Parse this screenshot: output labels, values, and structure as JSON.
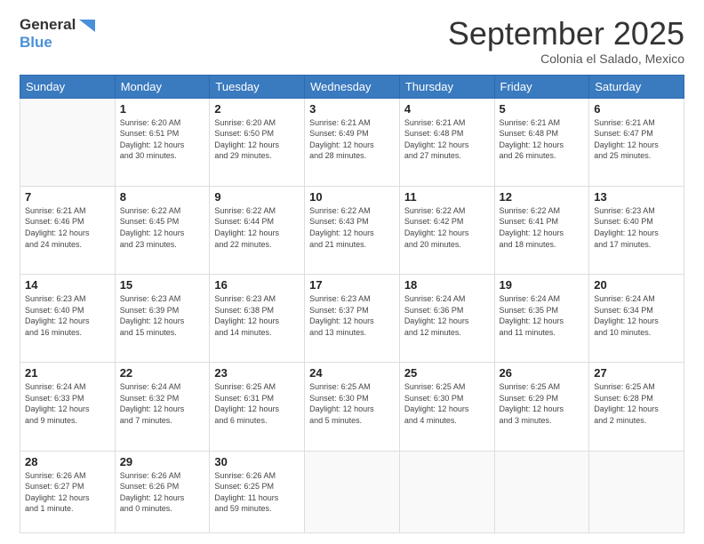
{
  "header": {
    "logo_general": "General",
    "logo_blue": "Blue",
    "month_title": "September 2025",
    "subtitle": "Colonia el Salado, Mexico"
  },
  "days_of_week": [
    "Sunday",
    "Monday",
    "Tuesday",
    "Wednesday",
    "Thursday",
    "Friday",
    "Saturday"
  ],
  "weeks": [
    [
      {
        "day": "",
        "info": ""
      },
      {
        "day": "1",
        "info": "Sunrise: 6:20 AM\nSunset: 6:51 PM\nDaylight: 12 hours\nand 30 minutes."
      },
      {
        "day": "2",
        "info": "Sunrise: 6:20 AM\nSunset: 6:50 PM\nDaylight: 12 hours\nand 29 minutes."
      },
      {
        "day": "3",
        "info": "Sunrise: 6:21 AM\nSunset: 6:49 PM\nDaylight: 12 hours\nand 28 minutes."
      },
      {
        "day": "4",
        "info": "Sunrise: 6:21 AM\nSunset: 6:48 PM\nDaylight: 12 hours\nand 27 minutes."
      },
      {
        "day": "5",
        "info": "Sunrise: 6:21 AM\nSunset: 6:48 PM\nDaylight: 12 hours\nand 26 minutes."
      },
      {
        "day": "6",
        "info": "Sunrise: 6:21 AM\nSunset: 6:47 PM\nDaylight: 12 hours\nand 25 minutes."
      }
    ],
    [
      {
        "day": "7",
        "info": "Sunrise: 6:21 AM\nSunset: 6:46 PM\nDaylight: 12 hours\nand 24 minutes."
      },
      {
        "day": "8",
        "info": "Sunrise: 6:22 AM\nSunset: 6:45 PM\nDaylight: 12 hours\nand 23 minutes."
      },
      {
        "day": "9",
        "info": "Sunrise: 6:22 AM\nSunset: 6:44 PM\nDaylight: 12 hours\nand 22 minutes."
      },
      {
        "day": "10",
        "info": "Sunrise: 6:22 AM\nSunset: 6:43 PM\nDaylight: 12 hours\nand 21 minutes."
      },
      {
        "day": "11",
        "info": "Sunrise: 6:22 AM\nSunset: 6:42 PM\nDaylight: 12 hours\nand 20 minutes."
      },
      {
        "day": "12",
        "info": "Sunrise: 6:22 AM\nSunset: 6:41 PM\nDaylight: 12 hours\nand 18 minutes."
      },
      {
        "day": "13",
        "info": "Sunrise: 6:23 AM\nSunset: 6:40 PM\nDaylight: 12 hours\nand 17 minutes."
      }
    ],
    [
      {
        "day": "14",
        "info": "Sunrise: 6:23 AM\nSunset: 6:40 PM\nDaylight: 12 hours\nand 16 minutes."
      },
      {
        "day": "15",
        "info": "Sunrise: 6:23 AM\nSunset: 6:39 PM\nDaylight: 12 hours\nand 15 minutes."
      },
      {
        "day": "16",
        "info": "Sunrise: 6:23 AM\nSunset: 6:38 PM\nDaylight: 12 hours\nand 14 minutes."
      },
      {
        "day": "17",
        "info": "Sunrise: 6:23 AM\nSunset: 6:37 PM\nDaylight: 12 hours\nand 13 minutes."
      },
      {
        "day": "18",
        "info": "Sunrise: 6:24 AM\nSunset: 6:36 PM\nDaylight: 12 hours\nand 12 minutes."
      },
      {
        "day": "19",
        "info": "Sunrise: 6:24 AM\nSunset: 6:35 PM\nDaylight: 12 hours\nand 11 minutes."
      },
      {
        "day": "20",
        "info": "Sunrise: 6:24 AM\nSunset: 6:34 PM\nDaylight: 12 hours\nand 10 minutes."
      }
    ],
    [
      {
        "day": "21",
        "info": "Sunrise: 6:24 AM\nSunset: 6:33 PM\nDaylight: 12 hours\nand 9 minutes."
      },
      {
        "day": "22",
        "info": "Sunrise: 6:24 AM\nSunset: 6:32 PM\nDaylight: 12 hours\nand 7 minutes."
      },
      {
        "day": "23",
        "info": "Sunrise: 6:25 AM\nSunset: 6:31 PM\nDaylight: 12 hours\nand 6 minutes."
      },
      {
        "day": "24",
        "info": "Sunrise: 6:25 AM\nSunset: 6:30 PM\nDaylight: 12 hours\nand 5 minutes."
      },
      {
        "day": "25",
        "info": "Sunrise: 6:25 AM\nSunset: 6:30 PM\nDaylight: 12 hours\nand 4 minutes."
      },
      {
        "day": "26",
        "info": "Sunrise: 6:25 AM\nSunset: 6:29 PM\nDaylight: 12 hours\nand 3 minutes."
      },
      {
        "day": "27",
        "info": "Sunrise: 6:25 AM\nSunset: 6:28 PM\nDaylight: 12 hours\nand 2 minutes."
      }
    ],
    [
      {
        "day": "28",
        "info": "Sunrise: 6:26 AM\nSunset: 6:27 PM\nDaylight: 12 hours\nand 1 minute."
      },
      {
        "day": "29",
        "info": "Sunrise: 6:26 AM\nSunset: 6:26 PM\nDaylight: 12 hours\nand 0 minutes."
      },
      {
        "day": "30",
        "info": "Sunrise: 6:26 AM\nSunset: 6:25 PM\nDaylight: 11 hours\nand 59 minutes."
      },
      {
        "day": "",
        "info": ""
      },
      {
        "day": "",
        "info": ""
      },
      {
        "day": "",
        "info": ""
      },
      {
        "day": "",
        "info": ""
      }
    ]
  ]
}
